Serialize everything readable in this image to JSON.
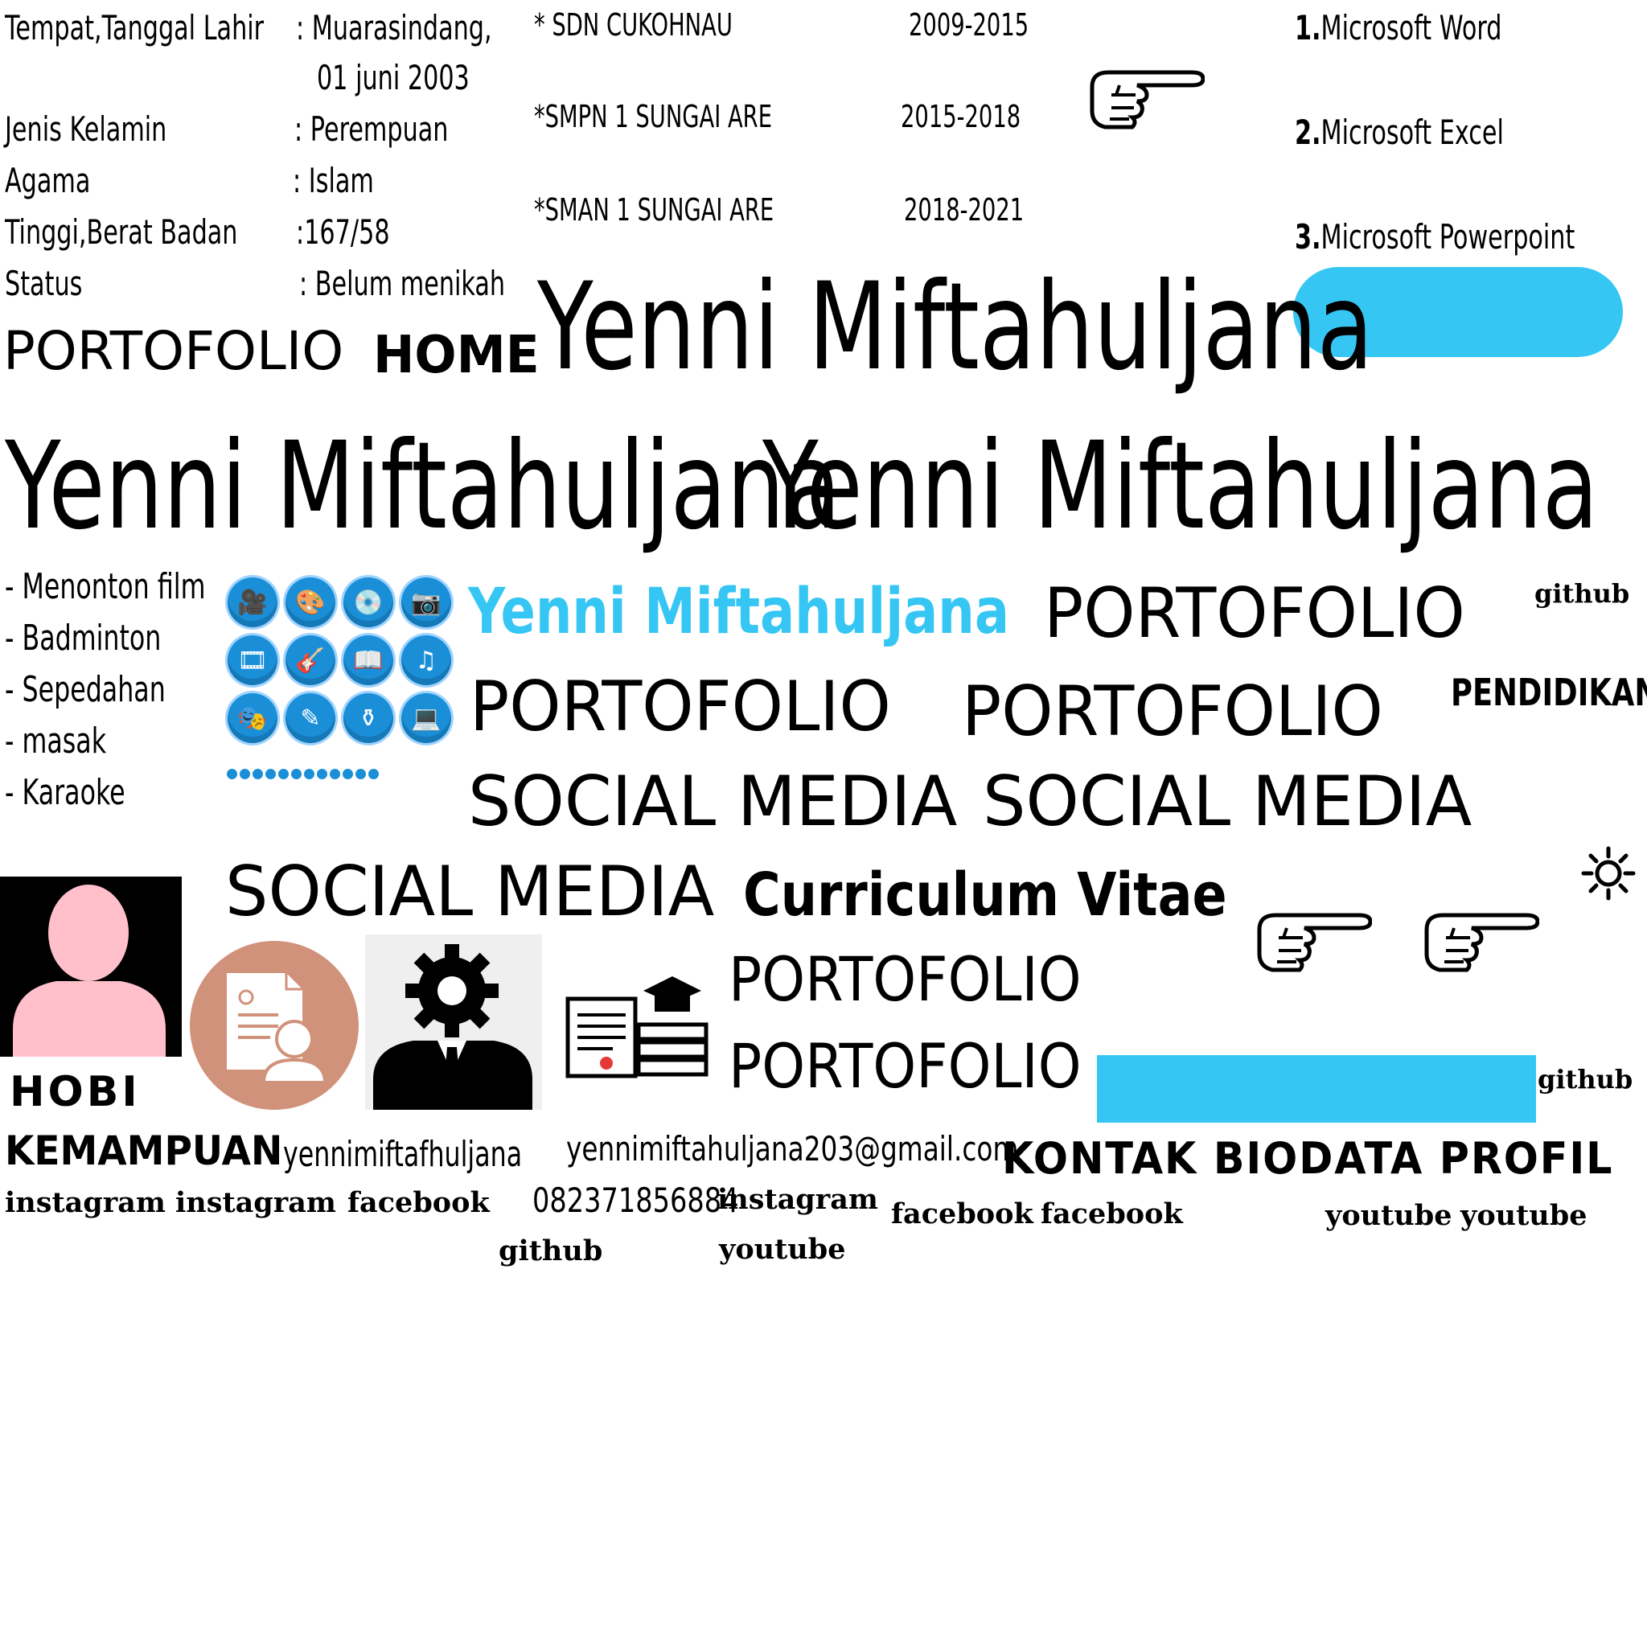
{
  "biodata": {
    "birth_label": "Tempat,Tanggal Lahir",
    "birth_value_1": ": Muarasindang,",
    "birth_value_2": "01 juni 2003",
    "gender_label": "Jenis Kelamin",
    "gender_value": ": Perempuan",
    "religion_label": "Agama",
    "religion_value": ": Islam",
    "height_weight_label": "Tinggi,Berat Badan",
    "height_weight_value": ":167/58",
    "status_label": "Status",
    "status_value": ": Belum menikah"
  },
  "education": [
    {
      "school": "* SDN CUKOHNAU",
      "years": "2009-2015"
    },
    {
      "school": "*SMPN 1 SUNGAI ARE",
      "years": "2015-2018"
    },
    {
      "school": "*SMAN 1 SUNGAI ARE",
      "years": "2018-2021"
    }
  ],
  "skills": [
    {
      "num": "1.",
      "name": "Microsoft Word"
    },
    {
      "num": "2.",
      "name": "Microsoft Excel"
    },
    {
      "num": "3.",
      "name": "Microsoft Powerpoint"
    }
  ],
  "nav": {
    "portofolio": "PORTOFOLIO",
    "home": "HOME",
    "pendidikan": "PENDIDIKAN",
    "social_media": "SOCIAL MEDIA",
    "curriculum_vitae": "Curriculum Vitae",
    "hobi": "HOBI",
    "kemampuan": "KEMAMPUAN",
    "kontak": "KONTAK",
    "biodata": "BIODATA",
    "profil": "PROFIL"
  },
  "name": "Yenni Miftahuljana",
  "hobbies": [
    "- Menonton film",
    "- Badminton",
    "- Sepedahan",
    "- masak",
    "- Karaoke"
  ],
  "contact": {
    "username": "yennimiftafhuljana",
    "email": "yennimiftahuljana203@gmail.com",
    "phone": "082371856884"
  },
  "social": {
    "instagram": "instagram",
    "facebook": "facebook",
    "youtube": "youtube",
    "github": "github"
  },
  "icons": {
    "pointing_hand": "pointing-hand-icon",
    "sun": "sun-icon",
    "avatar": "person-silhouette-icon",
    "cv": "resume-icon",
    "gear_person": "gear-head-person-icon",
    "diploma": "diploma-books-icon"
  },
  "colors": {
    "accent_blue": "#36c6f4",
    "avatar_pink": "#ffc0cb",
    "cv_circle": "#d0927a",
    "hobby_icon_blue": "#1a8fd8"
  }
}
